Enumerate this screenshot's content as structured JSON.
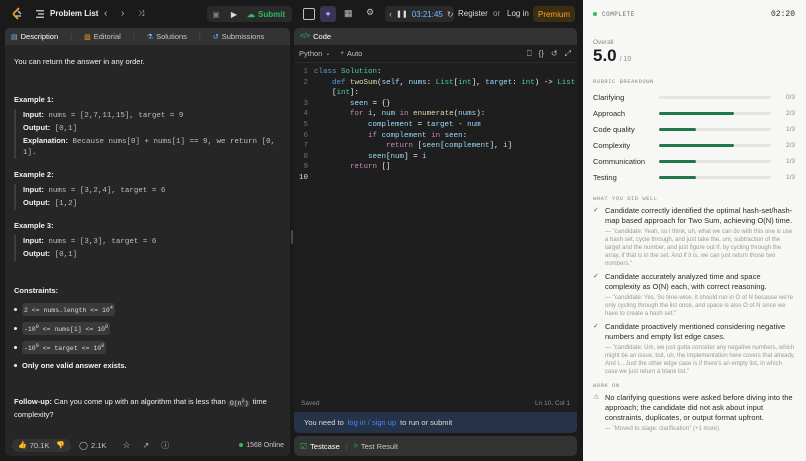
{
  "topbar": {
    "title": "Problem List",
    "submit": "Submit",
    "timer": "03:21:45",
    "register": "Register",
    "or": "or",
    "login": "Log in",
    "premium": "Premium"
  },
  "left_tabs": [
    {
      "label": "Description"
    },
    {
      "label": "Editorial"
    },
    {
      "label": "Solutions"
    },
    {
      "label": "Submissions"
    }
  ],
  "description": {
    "intro": "You can return the answer in any order.",
    "examples": [
      {
        "title": "Example 1:",
        "input": "nums = [2,7,11,15], target = 9",
        "output": "[0,1]",
        "explanation": "Because nums[0] + nums[1] == 9, we return [0, 1]."
      },
      {
        "title": "Example 2:",
        "input": "nums = [3,2,4], target = 6",
        "output": "[1,2]"
      },
      {
        "title": "Example 3:",
        "input": "nums = [3,3], target = 6",
        "output": "[0,1]"
      }
    ],
    "labels": {
      "input": "Input:",
      "output": "Output:",
      "explanation": "Explanation:"
    },
    "constraints_title": "Constraints:",
    "constraints": [
      {
        "a": "2 <= nums.length <= 10",
        "sup": "4"
      },
      {
        "a": "-10",
        "sup": "9",
        "b": " <= nums[i] <= 10",
        "sup2": "9"
      },
      {
        "a": "-10",
        "sup": "9",
        "b": " <= target <= 10",
        "sup2": "9"
      }
    ],
    "only_one": "Only one valid answer exists.",
    "followup_label": "Follow-up:",
    "followup_a": "Can you come up with an algorithm that is less than",
    "followup_code": "O(n",
    "followup_sup": "2",
    "followup_code_end": ")",
    "followup_b": "time complexity?"
  },
  "left_footer": {
    "likes": "70.1K",
    "comments": "2.1K",
    "online": "1568 Online"
  },
  "code": {
    "tab": "Code",
    "language": "Python",
    "auto": "Auto",
    "saved": "Saved",
    "cursor": "Ln 10, Col 1",
    "lines": [
      "class Solution:",
      "    def twoSum(self, nums: List[int], target: int) -> List",
      "    [int]:",
      "        seen = {}",
      "        for i, num in enumerate(nums):",
      "            complement = target - num",
      "            if complement in seen:",
      "                return [seen[complement], i]",
      "            seen[num] = i",
      "        return []",
      ""
    ],
    "line_numbers": [
      "1",
      "2",
      "",
      "3",
      "4",
      "5",
      "6",
      "7",
      "8",
      "9",
      "10"
    ],
    "login_prompt": {
      "pre": "You need to",
      "link": "log in / sign up",
      "post": "to run or submit"
    }
  },
  "bottom_tabs": {
    "testcase": "Testcase",
    "result": "Test Result"
  },
  "right_panel": {
    "status": "COMPLETE",
    "time": "02:20",
    "overall_label": "Overall",
    "overall_score": "5.0",
    "overall_max": "/ 10",
    "rubric_title": "RUBRIC BREAKDOWN",
    "rubric": [
      {
        "name": "Clarifying",
        "score": "0/3",
        "fraction": 0.0
      },
      {
        "name": "Approach",
        "score": "2/3",
        "fraction": 0.667
      },
      {
        "name": "Code quality",
        "score": "1/3",
        "fraction": 0.333
      },
      {
        "name": "Complexity",
        "score": "2/3",
        "fraction": 0.667
      },
      {
        "name": "Communication",
        "score": "1/3",
        "fraction": 0.333
      },
      {
        "name": "Testing",
        "score": "1/3",
        "fraction": 0.333
      }
    ],
    "well_title": "WHAT YOU DID WELL",
    "well": [
      {
        "text": "Candidate correctly identified the optimal hash-set/hash-map based approach for Two Sum, achieving O(N) time.",
        "quote": "— \"candidate: Yeah, so I think, uh, what we can do with this one is use a hash set, cycle through, and just take the, um, subtraction of the target and the number, and just figure out if, by cycling through the array, if that is in the set. And if it is, we can just return those two numbers.\""
      },
      {
        "text": "Candidate accurately analyzed time and space complexity as O(N) each, with correct reasoning.",
        "quote": "— \"candidate: Yes. So time-wise, it should run in O of N because we're only cycling through the list once, and space is also O of N since we have to create a hash set.\""
      },
      {
        "text": "Candidate proactively mentioned considering negative numbers and empty list edge cases.",
        "quote": "— \"candidate: Um, we just gotta consider any negative numbers, which might be an issue, but, uh, the implementation here covers that already. And I... Just the other edge case is if there's an empty list, in which case we just return a blank list.\""
      }
    ],
    "work_title": "WORK ON",
    "work": [
      {
        "text": "No clarifying questions were asked before diving into the approach; the candidate did not ask about input constraints, duplicates, or output format upfront.",
        "quote": "— \"Moved to stage: clarification\" (+1 more)"
      }
    ]
  }
}
